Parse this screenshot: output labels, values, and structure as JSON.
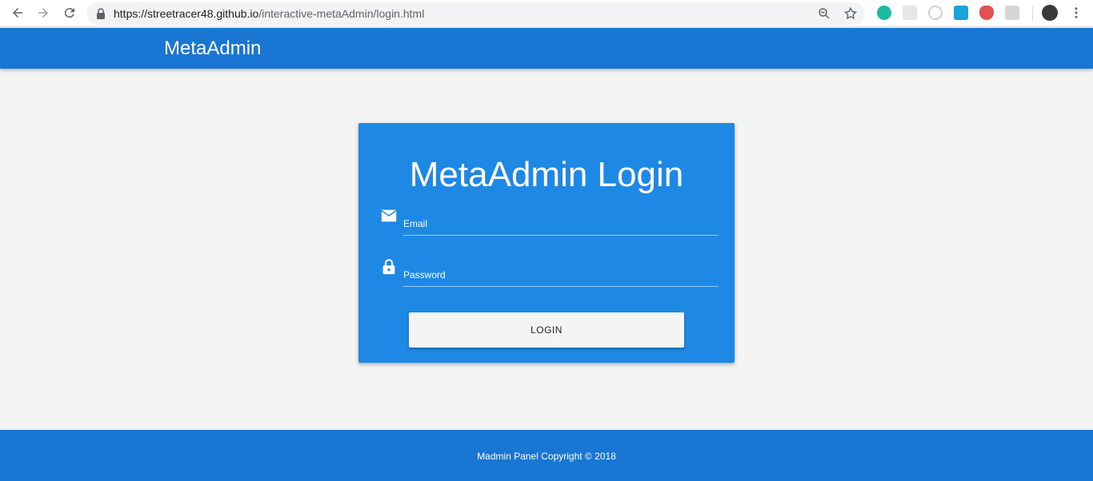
{
  "browser": {
    "url_host": "https://streetracer48.github.io",
    "url_path": "/interactive-metaAdmin/login.html"
  },
  "header": {
    "brand": "MetaAdmin"
  },
  "login": {
    "title": "MetaAdmin Login",
    "email_label": "Email",
    "password_label": "Password",
    "button_label": "LOGIN"
  },
  "footer": {
    "text": "Madmin Panel Copyright © 2018"
  },
  "colors": {
    "header": "#1976d2",
    "card": "#1e88e5",
    "page_bg": "#f4f4f4"
  },
  "icons": {
    "email": "mail-icon",
    "password": "lock-icon"
  }
}
